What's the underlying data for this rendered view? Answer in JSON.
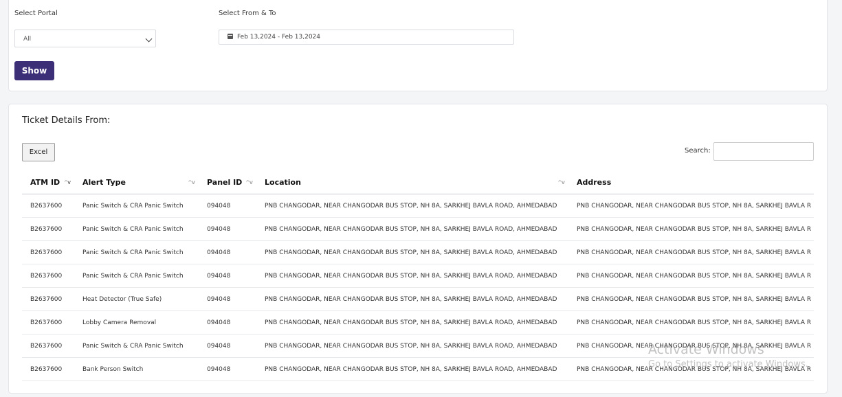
{
  "filters": {
    "portal_label": "Select Portal",
    "portal_value": "All",
    "date_label": "Select From & To",
    "date_value": "Feb 13,2024 - Feb 13,2024",
    "show_button": "Show"
  },
  "ticket_section": {
    "title": "Ticket Details From:",
    "excel_button": "Excel",
    "search_label": "Search:",
    "search_value": ""
  },
  "table": {
    "headers": [
      "ATM ID",
      "Alert Type",
      "Panel ID",
      "Location",
      "Address"
    ],
    "rows": [
      [
        "B2637600",
        "Panic Switch & CRA Panic Switch",
        "094048",
        "PNB CHANGODAR, NEAR CHANGODAR BUS STOP, NH 8A, SARKHEJ BAVLA ROAD, AHMEDABAD",
        "PNB CHANGODAR, NEAR CHANGODAR BUS STOP, NH 8A, SARKHEJ BAVLA R"
      ],
      [
        "B2637600",
        "Panic Switch & CRA Panic Switch",
        "094048",
        "PNB CHANGODAR, NEAR CHANGODAR BUS STOP, NH 8A, SARKHEJ BAVLA ROAD, AHMEDABAD",
        "PNB CHANGODAR, NEAR CHANGODAR BUS STOP, NH 8A, SARKHEJ BAVLA R"
      ],
      [
        "B2637600",
        "Panic Switch & CRA Panic Switch",
        "094048",
        "PNB CHANGODAR, NEAR CHANGODAR BUS STOP, NH 8A, SARKHEJ BAVLA ROAD, AHMEDABAD",
        "PNB CHANGODAR, NEAR CHANGODAR BUS STOP, NH 8A, SARKHEJ BAVLA R"
      ],
      [
        "B2637600",
        "Panic Switch & CRA Panic Switch",
        "094048",
        "PNB CHANGODAR, NEAR CHANGODAR BUS STOP, NH 8A, SARKHEJ BAVLA ROAD, AHMEDABAD",
        "PNB CHANGODAR, NEAR CHANGODAR BUS STOP, NH 8A, SARKHEJ BAVLA R"
      ],
      [
        "B2637600",
        "Heat Detector (True Safe)",
        "094048",
        "PNB CHANGODAR, NEAR CHANGODAR BUS STOP, NH 8A, SARKHEJ BAVLA ROAD, AHMEDABAD",
        "PNB CHANGODAR, NEAR CHANGODAR BUS STOP, NH 8A, SARKHEJ BAVLA R"
      ],
      [
        "B2637600",
        "Lobby Camera Removal",
        "094048",
        "PNB CHANGODAR, NEAR CHANGODAR BUS STOP, NH 8A, SARKHEJ BAVLA ROAD, AHMEDABAD",
        "PNB CHANGODAR, NEAR CHANGODAR BUS STOP, NH 8A, SARKHEJ BAVLA R"
      ],
      [
        "B2637600",
        "Panic Switch & CRA Panic Switch",
        "094048",
        "PNB CHANGODAR, NEAR CHANGODAR BUS STOP, NH 8A, SARKHEJ BAVLA ROAD, AHMEDABAD",
        "PNB CHANGODAR, NEAR CHANGODAR BUS STOP, NH 8A, SARKHEJ BAVLA R"
      ],
      [
        "B2637600",
        "Bank Person Switch",
        "094048",
        "PNB CHANGODAR, NEAR CHANGODAR BUS STOP, NH 8A, SARKHEJ BAVLA ROAD, AHMEDABAD",
        "PNB CHANGODAR, NEAR CHANGODAR BUS STOP, NH 8A, SARKHEJ BAVLA R"
      ]
    ]
  },
  "watermark": {
    "line1": "Activate Windows",
    "line2": "Go to Settings to activate Windows."
  },
  "colors": {
    "primary_button": "#3d2e78",
    "background": "#f4f5f7"
  }
}
